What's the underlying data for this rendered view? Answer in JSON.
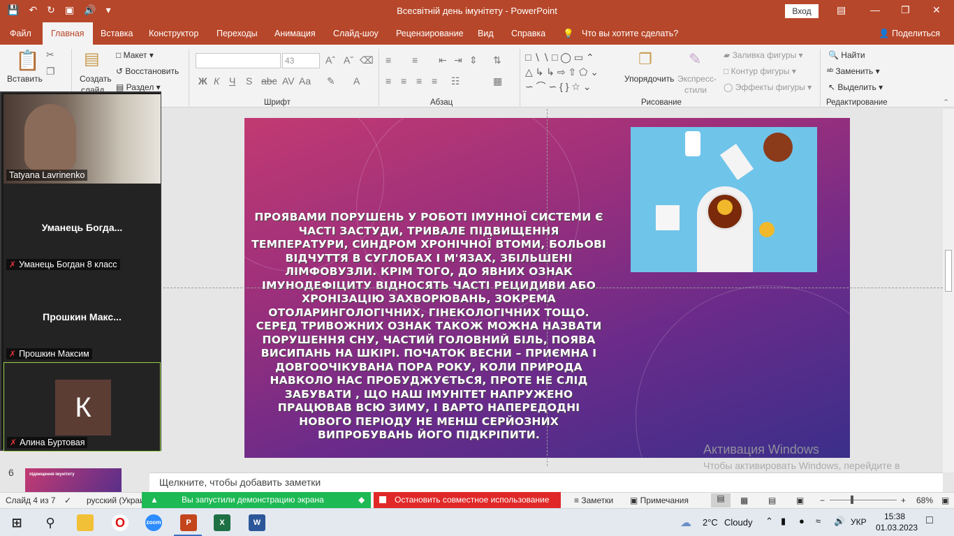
{
  "window": {
    "title": "Всесвітній день імунітету - PowerPoint",
    "signin_label": "Вход",
    "brand_color": "#b7472a"
  },
  "ribbon_tabs": [
    "Файл",
    "Главная",
    "Вставка",
    "Конструктор",
    "Переходы",
    "Анимация",
    "Слайд-шоу",
    "Рецензирование",
    "Вид",
    "Справка"
  ],
  "tell_me": "Что вы хотите сделать?",
  "share_label": "Поделиться",
  "ribbon": {
    "clipboard": {
      "paste": "Вставить"
    },
    "slides": {
      "new_slide_line1": "Создать",
      "new_slide_line2": "слайд",
      "layout": "Макет",
      "reset": "Восстановить",
      "section": "Раздел"
    },
    "font": {
      "group_label": "Шрифт",
      "size": "43"
    },
    "paragraph": {
      "group_label": "Абзац"
    },
    "drawing": {
      "group_label": "Рисование",
      "arrange": "Упорядочить",
      "quick_styles_line1": "Экспресс-",
      "quick_styles_line2": "стили",
      "fill": "Заливка фигуры",
      "outline": "Контур фигуры",
      "effects": "Эффекты фигуры"
    },
    "editing": {
      "group_label": "Редактирование",
      "find": "Найти",
      "replace": "Заменить",
      "select": "Выделить"
    }
  },
  "slide": {
    "body_text": "Проявами порушень у роботі імунної системи є часті застуди, тривале підвищення температури, синдром хронічної втоми, больові відчуття в суглобах і м'язах, збільшені лімфовузли. Крім того, до явних ознак імунодефіциту відносять часті рецидиви або хронізацію захворювань, зокрема отоларингологічних, гінекологічних тощо. Серед тривожних ознак також можна назвати порушення сну, частий головний біль, поява висипань на шкірі. Початок весни – приємна і довгоочікувана пора року, коли природа навколо нас пробуджується, проте не слід забувати , що наш імунітет напружено працював всю зиму, і варто напередодні нового періоду не менш серйозних випробувань його підкріпити."
  },
  "notes_placeholder": "Щелкните, чтобы добавить заметки",
  "watermark": {
    "title": "Активация Windows",
    "subtitle": "Чтобы активировать Windows, перейдите в раздел \"Параметры\"."
  },
  "thumbnails": {
    "visible_number": "6",
    "thumb_caption": "підвищення імунітету"
  },
  "zoom": {
    "participants": [
      {
        "tile_name": "",
        "label": "Tatyana Lavrinenko",
        "muted": false
      },
      {
        "tile_name": "Уманець Богда...",
        "label": "Уманець Богдан 8 класс",
        "muted": true
      },
      {
        "tile_name": "Прошкин Макс...",
        "label": "Прошкин Максим",
        "muted": true
      },
      {
        "tile_name": "",
        "label": "Алина Буртовая",
        "muted": true,
        "avatar_letter": "К"
      }
    ],
    "share_banner": "Вы запустили демонстрацию экрана",
    "stop_share": "Остановить совместное использование"
  },
  "status": {
    "slide_counter": "Слайд 4 из 7",
    "language": "русский (Украи",
    "notes": "Заметки",
    "comments": "Примечания",
    "zoom_level": "68%"
  },
  "taskbar": {
    "weather_temp": "2°C",
    "weather_desc": "Cloudy",
    "lang": "УКР",
    "time": "15:38",
    "date": "01.03.2023"
  }
}
